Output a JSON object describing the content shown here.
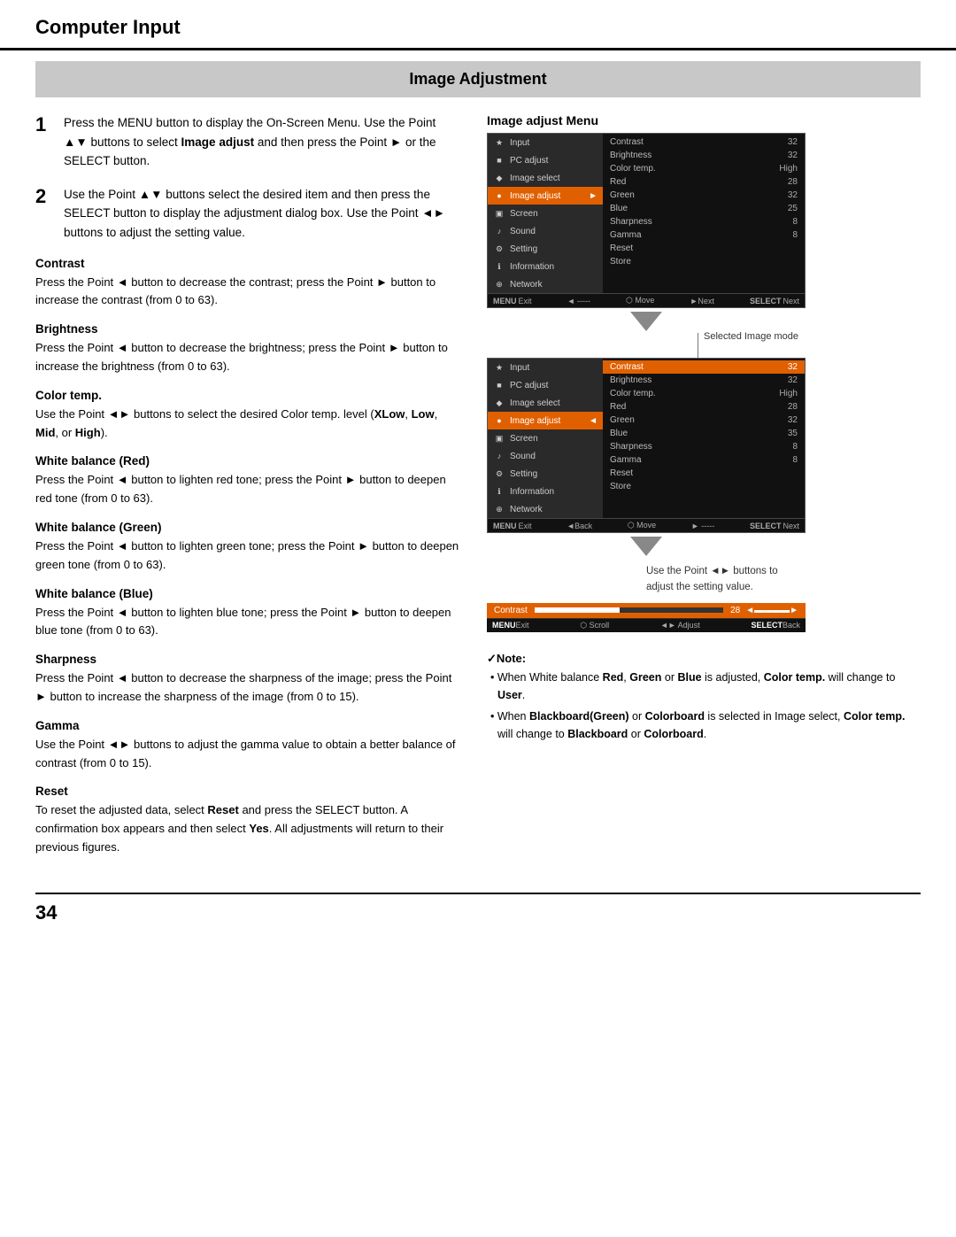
{
  "header": {
    "title": "Computer Input"
  },
  "section": {
    "title": "Image Adjustment"
  },
  "steps": [
    {
      "num": "1",
      "text": "Press the MENU button to display the On-Screen Menu. Use the Point ▲▼ buttons to select Image adjust and then press the Point ► or the SELECT button."
    },
    {
      "num": "2",
      "text": "Use the Point ▲▼ buttons select the desired item and then press the SELECT button to display the adjustment dialog box. Use the Point ◄► buttons to adjust the setting value."
    }
  ],
  "sections": [
    {
      "heading": "Contrast",
      "body": "Press the Point ◄ button to decrease the contrast; press the Point ► button to increase the contrast (from 0 to 63)."
    },
    {
      "heading": "Brightness",
      "body": "Press the Point ◄ button to decrease the brightness; press the Point ► button to increase the brightness (from 0 to 63)."
    },
    {
      "heading": "Color temp.",
      "body": "Use the Point ◄► buttons to select the desired Color temp. level (XLow, Low, Mid, or High)."
    },
    {
      "heading": "White balance (Red)",
      "body": "Press the Point ◄ button to lighten red tone; press the Point ► button to deepen red tone (from 0 to 63)."
    },
    {
      "heading": "White balance (Green)",
      "body": "Press the Point ◄ button to lighten green tone; press the Point ► button to deepen green tone (from 0 to 63)."
    },
    {
      "heading": "White balance (Blue)",
      "body": "Press the Point ◄ button to lighten blue tone; press the Point ► button to deepen blue tone (from 0 to 63)."
    },
    {
      "heading": "Sharpness",
      "body": "Press the Point ◄ button to decrease the sharpness of the image; press the Point ► button to increase the sharpness of the image (from 0 to 15)."
    },
    {
      "heading": "Gamma",
      "body": "Use the Point ◄► buttons to adjust the gamma value to obtain a better balance of contrast (from 0 to 15)."
    },
    {
      "heading": "Reset",
      "body": "To reset the adjusted data, select Reset and press the SELECT button. A confirmation box appears and then select Yes. All adjustments will return to their previous figures."
    }
  ],
  "menu_label": "Image adjust Menu",
  "menu1": {
    "sidebar_items": [
      {
        "label": "Input",
        "active": false,
        "icon": "★"
      },
      {
        "label": "PC adjust",
        "active": false,
        "icon": "■"
      },
      {
        "label": "Image select",
        "active": false,
        "icon": "◆"
      },
      {
        "label": "Image adjust",
        "active": true,
        "icon": "●"
      },
      {
        "label": "Screen",
        "active": false,
        "icon": "▣"
      },
      {
        "label": "Sound",
        "active": false,
        "icon": "♪"
      },
      {
        "label": "Setting",
        "active": false,
        "icon": "⚙"
      },
      {
        "label": "Information",
        "active": false,
        "icon": "ℹ"
      },
      {
        "label": "Network",
        "active": false,
        "icon": "⊕"
      }
    ],
    "main_rows": [
      {
        "label": "Contrast",
        "val": "32"
      },
      {
        "label": "Brightness",
        "val": "32"
      },
      {
        "label": "Color temp.",
        "val": "High"
      },
      {
        "label": "Red",
        "val": "28"
      },
      {
        "label": "Green",
        "val": "32"
      },
      {
        "label": "Blue",
        "val": "25"
      },
      {
        "label": "Sharpness",
        "val": "8"
      },
      {
        "label": "Gamma",
        "val": "8"
      },
      {
        "label": "Reset",
        "val": ""
      },
      {
        "label": "Store",
        "val": ""
      }
    ],
    "footer": [
      "MENUExit",
      "◄ -----",
      "⬡ Move",
      "►Next",
      "SELECTNext"
    ]
  },
  "menu2": {
    "sidebar_items": [
      {
        "label": "Input",
        "active": false,
        "icon": "★"
      },
      {
        "label": "PC adjust",
        "active": false,
        "icon": "■"
      },
      {
        "label": "Image select",
        "active": false,
        "icon": "◆"
      },
      {
        "label": "Image adjust",
        "active": true,
        "icon": "●"
      },
      {
        "label": "Screen",
        "active": false,
        "icon": "▣"
      },
      {
        "label": "Sound",
        "active": false,
        "icon": "♪"
      },
      {
        "label": "Setting",
        "active": false,
        "icon": "⚙"
      },
      {
        "label": "Information",
        "active": false,
        "icon": "ℹ"
      },
      {
        "label": "Network",
        "active": false,
        "icon": "⊕"
      }
    ],
    "main_rows": [
      {
        "label": "Contrast",
        "val": "32",
        "highlight": true
      },
      {
        "label": "Brightness",
        "val": "32"
      },
      {
        "label": "Color temp.",
        "val": "High"
      },
      {
        "label": "Red",
        "val": "28"
      },
      {
        "label": "Green",
        "val": "32"
      },
      {
        "label": "Blue",
        "val": "35"
      },
      {
        "label": "Sharpness",
        "val": "8"
      },
      {
        "label": "Gamma",
        "val": "8"
      },
      {
        "label": "Reset",
        "val": ""
      },
      {
        "label": "Store",
        "val": ""
      }
    ],
    "footer": [
      "MENUExit",
      "◄Back",
      "⬡ Move",
      "► -----",
      "SELECTNext"
    ]
  },
  "selected_image_mode_label": "Selected Image mode",
  "setting_value_note": "Use the Point ◄► buttons to adjust the setting value.",
  "contrast_bar": {
    "label": "Contrast",
    "value": "28",
    "footer": [
      "MENUExit",
      "⬡ Scroll",
      "◄► Adjust",
      "SELECTBack"
    ]
  },
  "note": {
    "title": "✓Note:",
    "items": [
      "When White balance Red, Green or Blue is adjusted, Color temp. will change to User.",
      "When Blackboard(Green) or Colorboard is selected in Image select, Color temp. will change to Blackboard or Colorboard."
    ]
  },
  "page_number": "34"
}
